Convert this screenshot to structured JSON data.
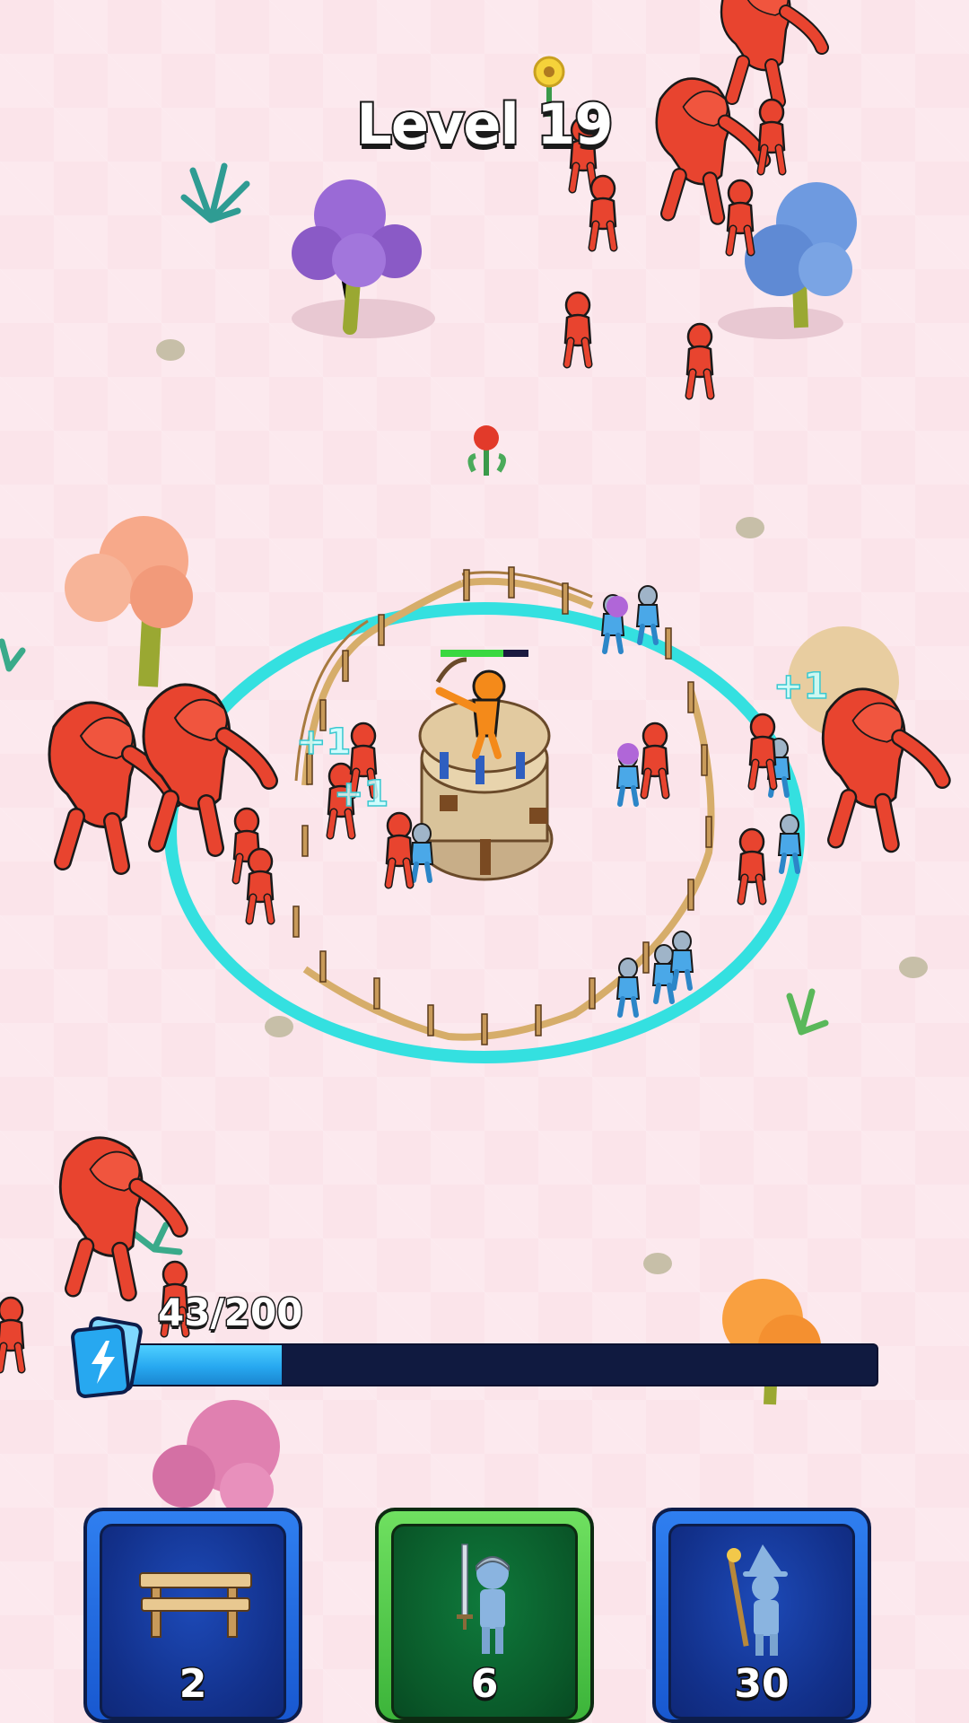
{
  "hud": {
    "level_title": "Level 19",
    "xp": {
      "text": "43/200",
      "current": 43,
      "max": 200,
      "icon": "energy-card-icon"
    }
  },
  "cards": [
    {
      "id": "fence",
      "count": "2",
      "icon": "fence-icon",
      "style": "blue"
    },
    {
      "id": "swordsman",
      "count": "6",
      "icon": "swordsman-icon",
      "style": "green"
    },
    {
      "id": "wizard",
      "count": "30",
      "icon": "wizard-icon",
      "style": "blue"
    }
  ],
  "floating_texts": [
    {
      "id": "plus-left",
      "text": "+1"
    },
    {
      "id": "plus-mid",
      "text": "+1"
    },
    {
      "id": "plus-right",
      "text": "+1"
    }
  ],
  "colors": {
    "ground": "#fbe4ea",
    "enemy": "#e8442f",
    "ally": "#4aa8e8",
    "range_ring": "#34e0e0",
    "xp_fill": "#27a8f0",
    "xp_track": "#101a40"
  }
}
